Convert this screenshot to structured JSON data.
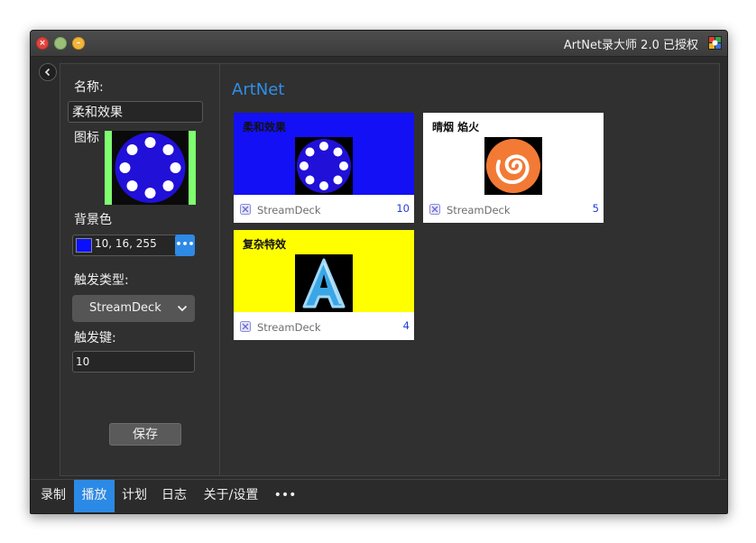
{
  "window": {
    "title": "ArtNet录大师 2.0 已授权",
    "close_glyph": "×",
    "min_glyph": "",
    "max_glyph": "–"
  },
  "editor": {
    "name_label": "名称:",
    "name_value": "柔和效果",
    "icon_label": "图标",
    "bgcolor_label": "背景色",
    "bgcolor_value": "10, 16, 255",
    "bgcolor_hex": "#0a10ff",
    "bgcolor_button": "•••",
    "trigger_type_label": "触发类型:",
    "trigger_type_value": "StreamDeck",
    "trigger_key_label": "触发键:",
    "trigger_key_value": "10",
    "save_label": "保存"
  },
  "main": {
    "section_title": "ArtNet",
    "cards": [
      {
        "name": "柔和效果",
        "background": "#1410f5",
        "icon": "circle-dots-icon",
        "trigger": "StreamDeck",
        "key": "10"
      },
      {
        "name": "晴烟 焰火",
        "background": "#ffffff",
        "icon": "spiral-icon",
        "trigger": "StreamDeck",
        "key": "5"
      },
      {
        "name": "复杂特效",
        "background": "#ffff00",
        "icon": "letter-a-icon",
        "trigger": "StreamDeck",
        "key": "4"
      }
    ]
  },
  "tabs": [
    {
      "label": "录制",
      "active": false
    },
    {
      "label": "播放",
      "active": true
    },
    {
      "label": "计划",
      "active": false
    },
    {
      "label": "日志",
      "active": false
    },
    {
      "label": "关于/设置",
      "active": false
    },
    {
      "label": "•••",
      "active": false
    }
  ],
  "colors": {
    "accent": "#2b8ae6",
    "panel": "#303030",
    "titlebar": "#404040"
  }
}
